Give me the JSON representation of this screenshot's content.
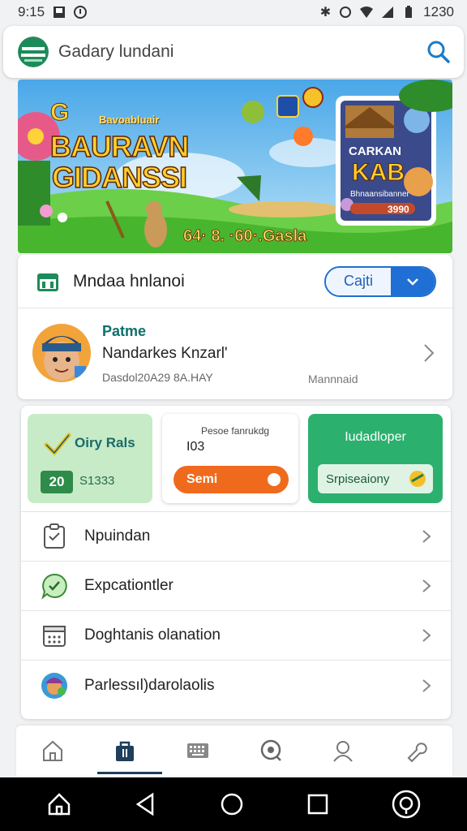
{
  "status_bar": {
    "time": "9:15",
    "clock_right": "1230"
  },
  "search": {
    "placeholder": "Gadary lundani"
  },
  "banner": {
    "pre_title": "Bavoabluair",
    "badge": "G",
    "title_line1": "BAURAVN",
    "title_line2": "GIDANSSI",
    "prices": "64· 8. ·60·.Gasla",
    "card_title1": "CARKAN",
    "card_title2": "KAB",
    "card_sub": "Bhnaansibanner",
    "card_price": "3990"
  },
  "account": {
    "title": "Mndaa hnlanoi",
    "region": "Cajti",
    "profile_role": "Patme",
    "profile_name": "Nandarkes Knzarl'",
    "profile_meta": "Dasdol20A29 8A.HAY",
    "profile_status": "Mannnaid"
  },
  "tiles": {
    "tile1_label": "Oiry Rals",
    "tile1_count": "20",
    "tile1_count_text": "S1333",
    "tile2_title": "Pesoe fanrukdg",
    "tile2_value": "I03",
    "tile2_button": "Semi",
    "tile3_title": "Iudadloper",
    "tile3_button": "Srpiseaiony"
  },
  "list": [
    {
      "label": "Npuindan",
      "icon": "clipboard-icon"
    },
    {
      "label": "Expcationtler",
      "icon": "chat-check-icon"
    },
    {
      "label": "Doghtanis olanation",
      "icon": "calculator-icon"
    },
    {
      "label": "Parlessıl)darolaolis",
      "icon": "game-avatar-icon"
    }
  ],
  "bottom_nav": [
    "home",
    "store",
    "keyboard",
    "search",
    "profile",
    "settings"
  ],
  "colors": {
    "accent_blue": "#1f6fd4",
    "orange": "#ef6a1c",
    "green": "#2cb06e",
    "teal_text": "#0e6f6a"
  }
}
